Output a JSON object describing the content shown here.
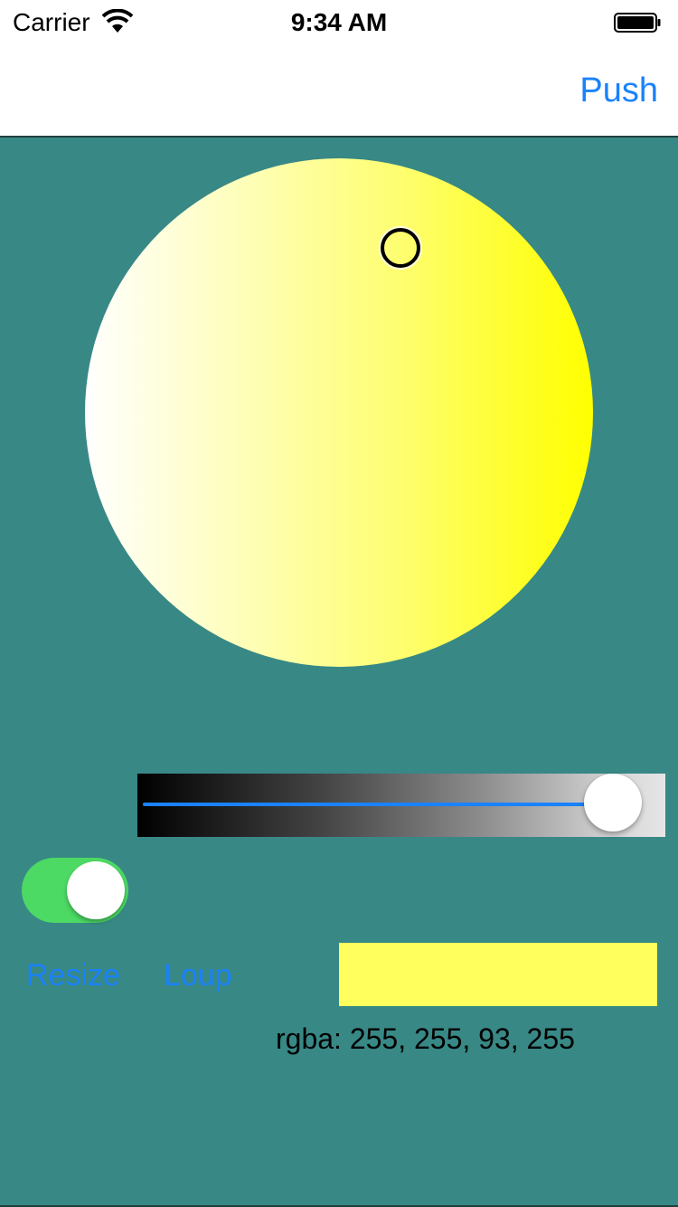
{
  "status_bar": {
    "carrier": "Carrier",
    "time": "9:34 AM",
    "wifi_icon": "wifi-icon",
    "battery_icon": "battery-icon"
  },
  "nav_bar": {
    "push_label": "Push"
  },
  "color_picker": {
    "wheel_start_color": "#ffffff",
    "wheel_end_color": "#ffff00"
  },
  "brightness": {
    "value": 0.95
  },
  "toggle": {
    "on": true,
    "on_color": "#4cd964"
  },
  "buttons": {
    "resize_label": "Resize",
    "loup_label": "Loup"
  },
  "result": {
    "swatch_color": "#ffff5d",
    "rgba_text": "rgba: 255, 255, 93, 255"
  },
  "colors": {
    "background": "#388886",
    "accent": "#1a82fb"
  }
}
